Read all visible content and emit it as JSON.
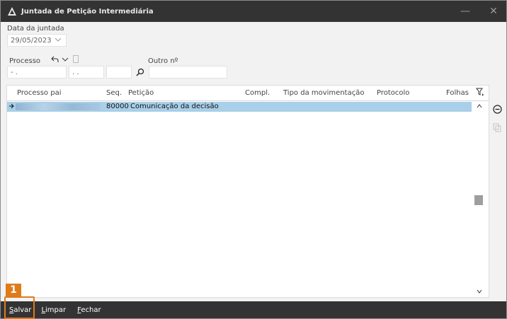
{
  "window": {
    "title": "Juntada de Petição Intermediária",
    "minimize_label": "—",
    "close_label": "✕"
  },
  "form": {
    "date_label": "Data da juntada",
    "date_value": "29/05/2023",
    "processo_label": "Processo",
    "processo_parts": [
      " - .",
      ". .",
      "",
      ""
    ],
    "outro_label": "Outro nº",
    "outro_value": ""
  },
  "grid": {
    "columns": [
      "Processo pai",
      "Seq.",
      "Petição",
      "Compl.",
      "Tipo da movimentação",
      "Protocolo",
      "Folhas"
    ],
    "rows": [
      {
        "processo_pai": "",
        "seq": "80000",
        "peticao": "Comunicação da decisão",
        "compl": "",
        "tipo": "",
        "protocolo": "",
        "folhas": ""
      }
    ]
  },
  "footer": {
    "salvar_first": "S",
    "salvar_rest": "alvar",
    "limpar_first": "L",
    "limpar_rest": "impar",
    "fechar_first": "F",
    "fechar_rest": "echar"
  },
  "annotation": {
    "step_number": "1"
  },
  "colors": {
    "titlebar": "#333333",
    "selected_row": "#a9cfe9",
    "highlight": "#e07b1a"
  }
}
